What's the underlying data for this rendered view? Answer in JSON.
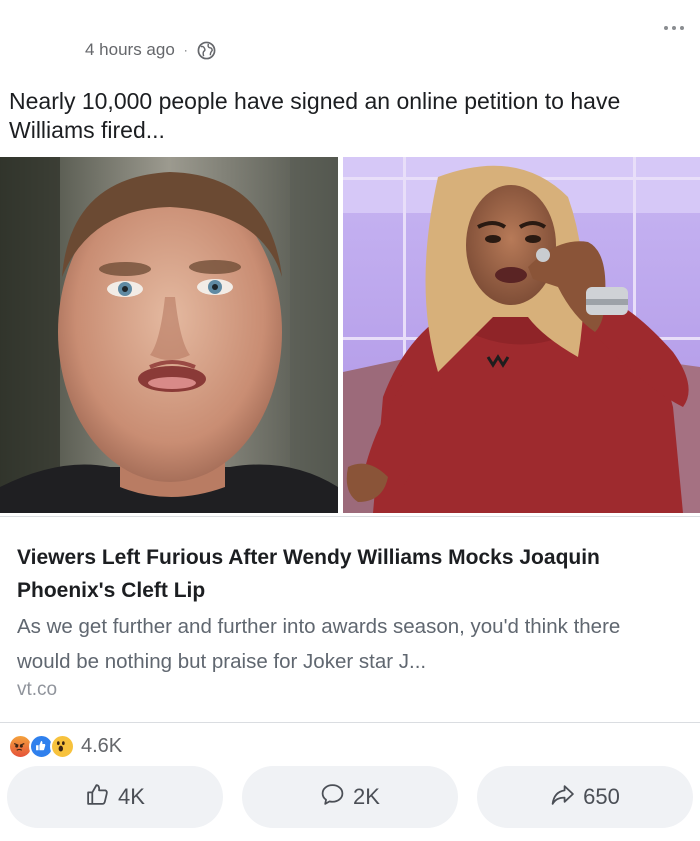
{
  "post": {
    "timestamp": "4 hours ago",
    "separator": "·",
    "privacy_icon": "globe-icon",
    "more_icon": "more-options-icon",
    "caption": "Nearly 10,000 people have signed an online petition to have Williams fired..."
  },
  "link": {
    "title": "Viewers Left Furious After Wendy Williams Mocks Joaquin Phoenix's Cleft Lip",
    "description": "As we get further and further into awards season, you'd think there would be nothing but praise for Joker star J...",
    "domain": "vt.co"
  },
  "reactions": {
    "icons": [
      "angry-reaction-icon",
      "like-reaction-icon",
      "wow-reaction-icon"
    ],
    "count": "4.6K"
  },
  "actions": {
    "like_count": "4K",
    "comment_count": "2K",
    "share_count": "650"
  },
  "colors": {
    "button_bg": "#f0f2f5",
    "meta_text": "#65676b",
    "link_desc": "#606770",
    "like_blue": "#2f80ed"
  }
}
